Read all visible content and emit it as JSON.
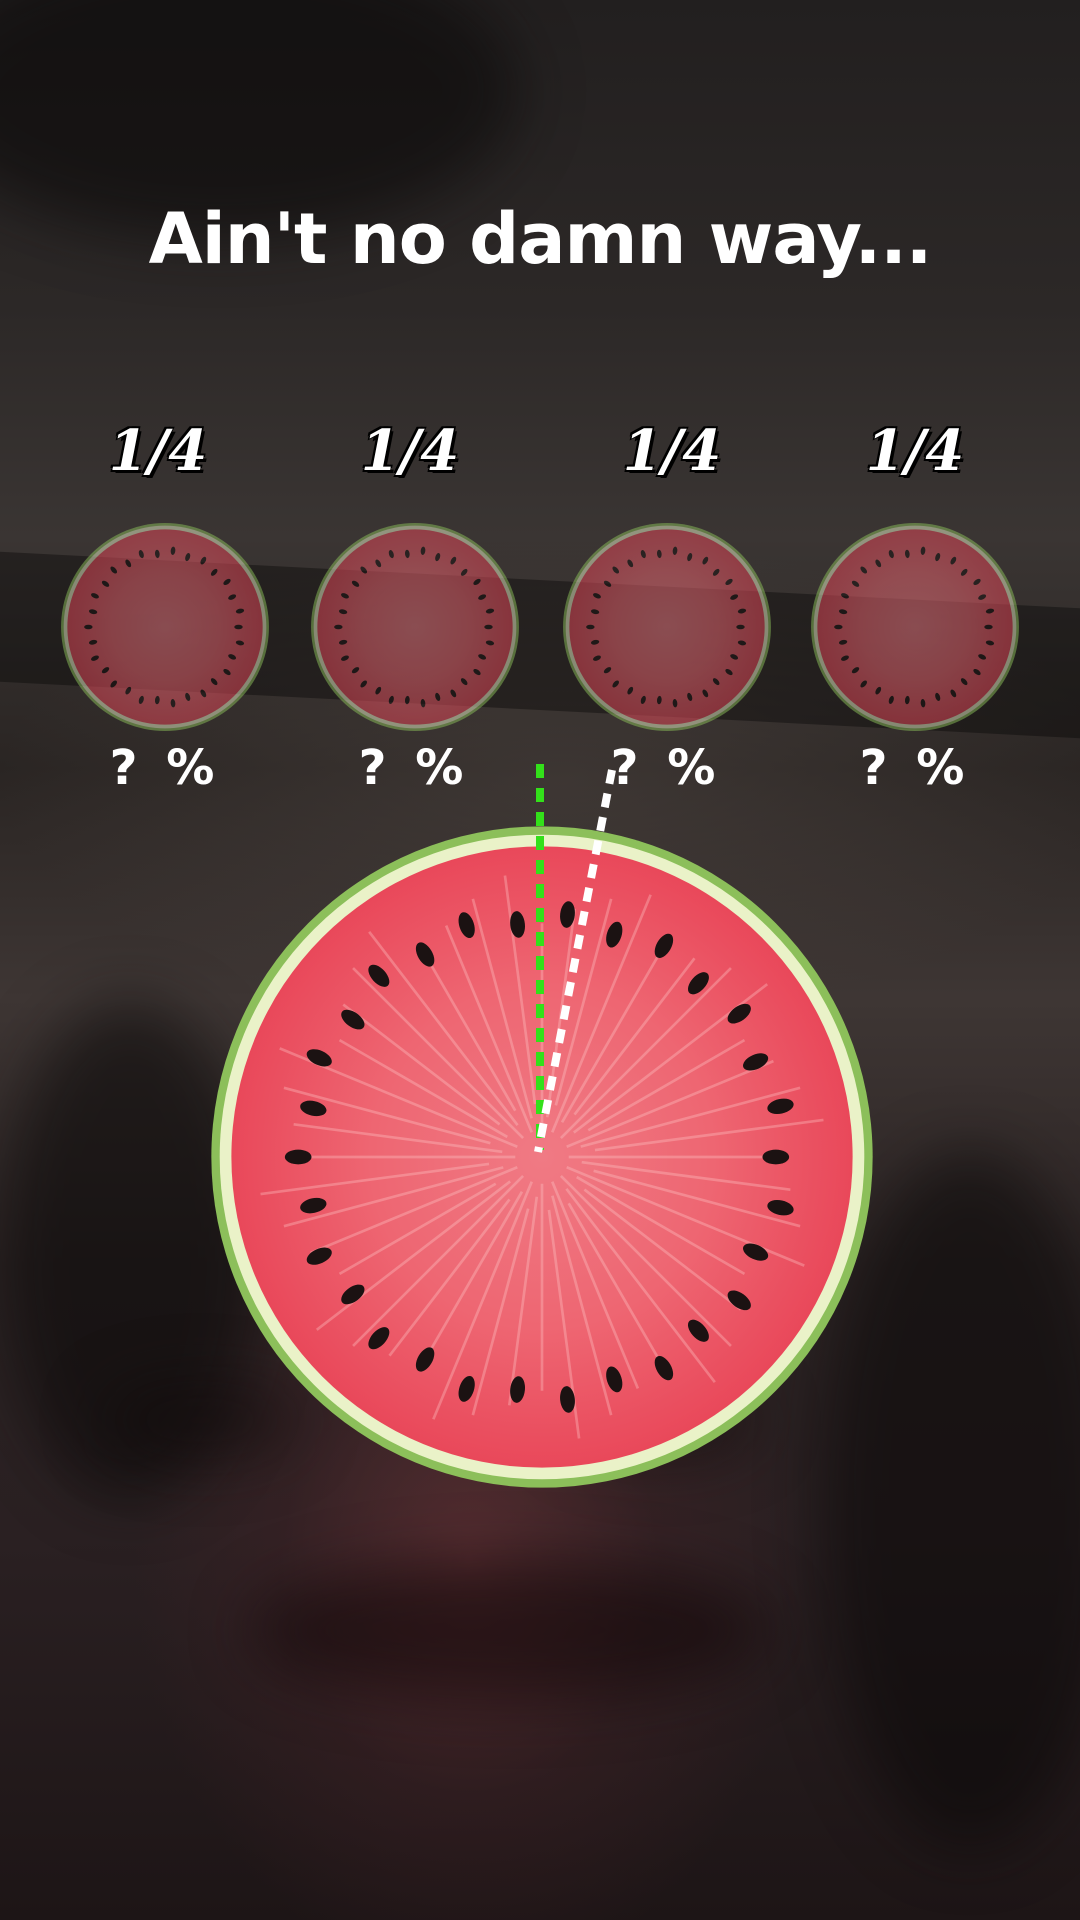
{
  "headline": "Ain't no damn way...",
  "portions": [
    {
      "fraction": "1/4",
      "percent": "? %"
    },
    {
      "fraction": "1/4",
      "percent": "? %"
    },
    {
      "fraction": "1/4",
      "percent": "? %"
    },
    {
      "fraction": "1/4",
      "percent": "? %"
    }
  ],
  "colors": {
    "flesh": "#e9485a",
    "flesh_center": "#f07a84",
    "rind_light": "#eaf2c8",
    "rind_green": "#8cbf5a",
    "seed": "#1b1212",
    "target_line": "#33e01a",
    "cut_line": "#ffffff"
  },
  "icons": [
    "watermelon-slice-icon"
  ]
}
